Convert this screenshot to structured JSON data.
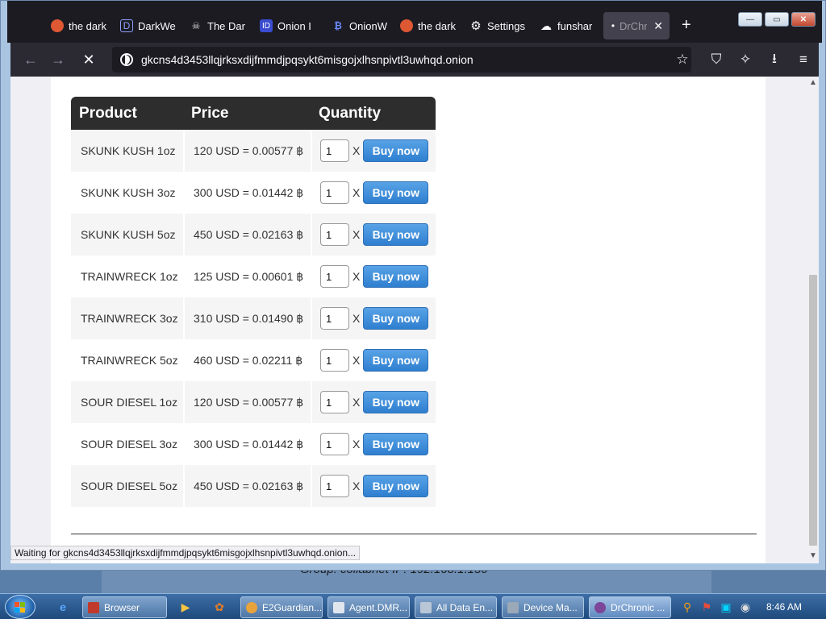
{
  "desktop": {
    "info": "Group: collabnet   IP: 192.168.1.150"
  },
  "browser": {
    "tabs": [
      {
        "label": "the dark",
        "icon": "duckduckgo-icon",
        "color": "#de5833"
      },
      {
        "label": "DarkWe",
        "icon": "darkweb-icon",
        "color": "#4a5ad0"
      },
      {
        "label": "The Dar",
        "icon": "skull-icon",
        "color": "#cccccc"
      },
      {
        "label": "Onion I",
        "icon": "onion-id-icon",
        "color": "#3a4cd0"
      },
      {
        "label": "OnionW",
        "icon": "bitcoin-icon",
        "color": "#4a7ad0"
      },
      {
        "label": "the dark",
        "icon": "duckduckgo-icon",
        "color": "#de5833"
      },
      {
        "label": "Settings",
        "icon": "gear-icon",
        "color": "#fbfbfe"
      },
      {
        "label": "funshar",
        "icon": "cloud-icon",
        "color": "#fbfbfe"
      },
      {
        "label": "DrChr",
        "icon": "dot-icon",
        "color": "#fbfbfe"
      }
    ],
    "new_tab": "+",
    "window_controls": {
      "minimize": "—",
      "maximize": "▭",
      "close": "✕"
    },
    "url": "gkcns4d3453llqjrksxdijfmmdjpqsykt6misgojxlhsnpivtl3uwhqd.onion",
    "status": "Waiting for gkcns4d3453llqjrksxdijfmmdjpqsykt6misgojxlhsnpivtl3uwhqd.onion..."
  },
  "table": {
    "headers": {
      "product": "Product",
      "price": "Price",
      "quantity": "Quantity"
    },
    "rows": [
      {
        "product": "SKUNK KUSH 1oz",
        "price": "120 USD = 0.00577 ฿",
        "qty": "1",
        "x": "X",
        "buy": "Buy now"
      },
      {
        "product": "SKUNK KUSH 3oz",
        "price": "300 USD = 0.01442 ฿",
        "qty": "1",
        "x": "X",
        "buy": "Buy now"
      },
      {
        "product": "SKUNK KUSH 5oz",
        "price": "450 USD = 0.02163 ฿",
        "qty": "1",
        "x": "X",
        "buy": "Buy now"
      },
      {
        "product": "TRAINWRECK 1oz",
        "price": "125 USD = 0.00601 ฿",
        "qty": "1",
        "x": "X",
        "buy": "Buy now"
      },
      {
        "product": "TRAINWRECK 3oz",
        "price": "310 USD = 0.01490 ฿",
        "qty": "1",
        "x": "X",
        "buy": "Buy now"
      },
      {
        "product": "TRAINWRECK 5oz",
        "price": "460 USD = 0.02211 ฿",
        "qty": "1",
        "x": "X",
        "buy": "Buy now"
      },
      {
        "product": "SOUR DIESEL 1oz",
        "price": "120 USD = 0.00577 ฿",
        "qty": "1",
        "x": "X",
        "buy": "Buy now"
      },
      {
        "product": "SOUR DIESEL 3oz",
        "price": "300 USD = 0.01442 ฿",
        "qty": "1",
        "x": "X",
        "buy": "Buy now"
      },
      {
        "product": "SOUR DIESEL 5oz",
        "price": "450 USD = 0.02163 ฿",
        "qty": "1",
        "x": "X",
        "buy": "Buy now"
      }
    ]
  },
  "taskbar": {
    "tasks": [
      {
        "label": "Browser",
        "icon": "browser-icon",
        "color": "#c0392b"
      },
      {
        "label": "E2Guardian...",
        "icon": "chrome-icon",
        "color": "#e8a33b"
      },
      {
        "label": "Agent.DMR...",
        "icon": "agent-icon",
        "color": "#dfe6ee"
      },
      {
        "label": "All Data En...",
        "icon": "data-icon",
        "color": "#b9c6d6"
      },
      {
        "label": "Device Ma...",
        "icon": "device-manager-icon",
        "color": "#9aa8b8"
      },
      {
        "label": "DrChronic ...",
        "icon": "tor-icon",
        "color": "#7d4698"
      }
    ],
    "clock": "8:46 AM"
  }
}
